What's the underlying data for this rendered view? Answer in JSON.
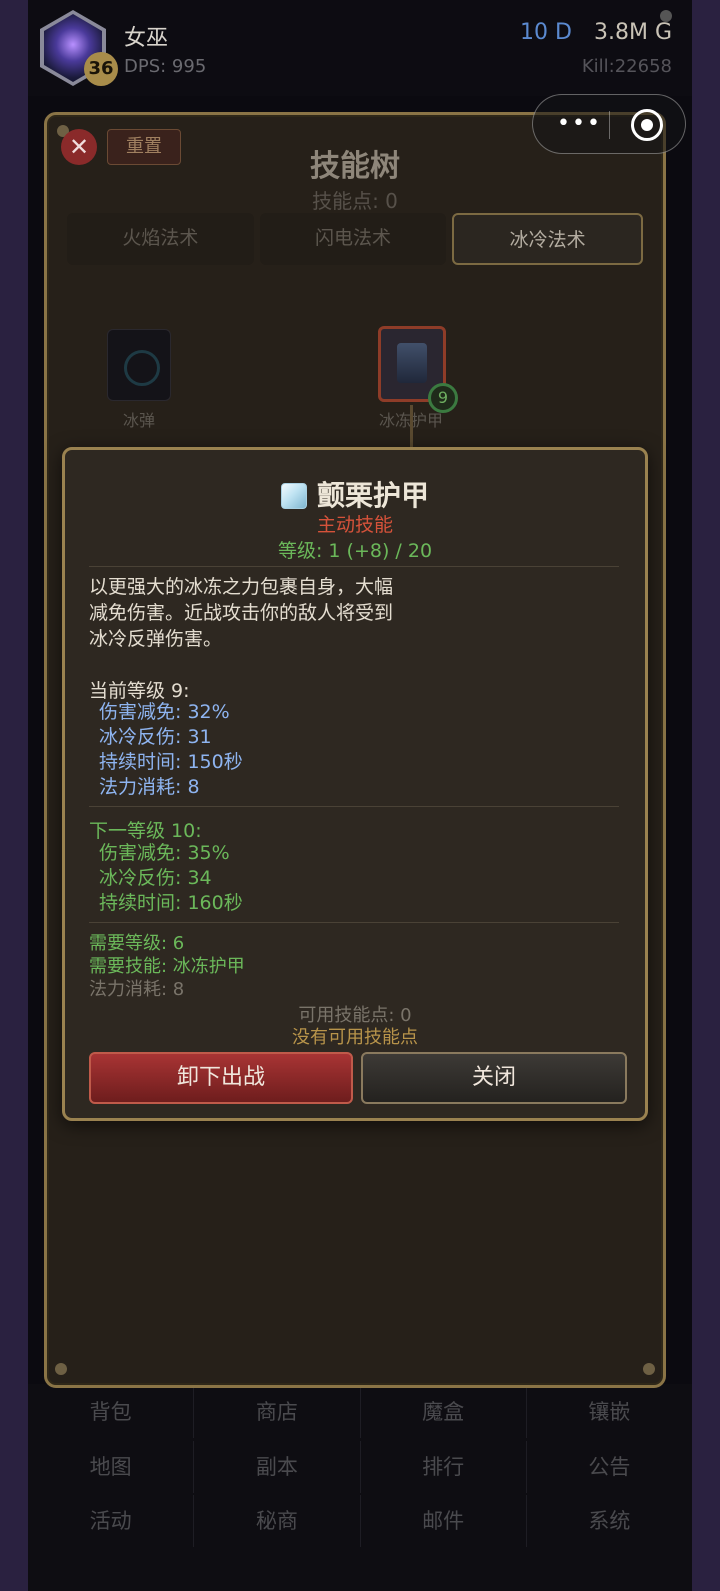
{
  "header": {
    "hero_name": "女巫",
    "hero_level": "36",
    "dps": "DPS: 995",
    "diamonds": "10 D",
    "gold": "3.8M G",
    "kills": "Kill:22658"
  },
  "skill_tree": {
    "close_label": "✕",
    "reset_label": "重置",
    "title": "技能树",
    "skill_points": "技能点: 0",
    "tabs": [
      {
        "label": "火焰法术",
        "active": false
      },
      {
        "label": "闪电法术",
        "active": false
      },
      {
        "label": "冰冷法术",
        "active": true
      }
    ],
    "nodes": [
      {
        "label": "冰弹"
      },
      {
        "label": "冰冻护甲",
        "level": "9"
      }
    ]
  },
  "skill_detail": {
    "icon": "ice-cube-icon",
    "name": "颤栗护甲",
    "type": "主动技能",
    "level": "等级: 1 (+8) / 20",
    "description": [
      "以更强大的冰冻之力包裹自身，大幅",
      "减免伤害。近战攻击你的敌人将受到",
      "冰冷反弹伤害。"
    ],
    "current": {
      "title": "当前等级 9:",
      "stats": [
        "伤害减免: 32%",
        "冰冷反伤: 31",
        "持续时间: 150秒",
        "法力消耗: 8"
      ]
    },
    "next": {
      "title": "下一等级 10:",
      "stats": [
        "伤害减免: 35%",
        "冰冷反伤: 34",
        "持续时间: 160秒"
      ]
    },
    "requirements": [
      "需要等级: 6",
      "需要技能: 冰冻护甲",
      "法力消耗: 8"
    ],
    "available_points": "可用技能点: 0",
    "no_points": "没有可用技能点",
    "unequip_label": "卸下出战",
    "close_label": "关闭"
  },
  "bottom_menu": [
    [
      "背包",
      "商店",
      "魔盒",
      "镶嵌"
    ],
    [
      "地图",
      "副本",
      "排行",
      "公告"
    ],
    [
      "活动",
      "秘商",
      "邮件",
      "系统"
    ]
  ],
  "colors": {
    "panel_border": "#8a7446",
    "active_skill_type": "#d5523a",
    "level_green": "#6bb85a",
    "current_stat_blue": "#8eb4f0",
    "unequip_red": "#a83434"
  }
}
